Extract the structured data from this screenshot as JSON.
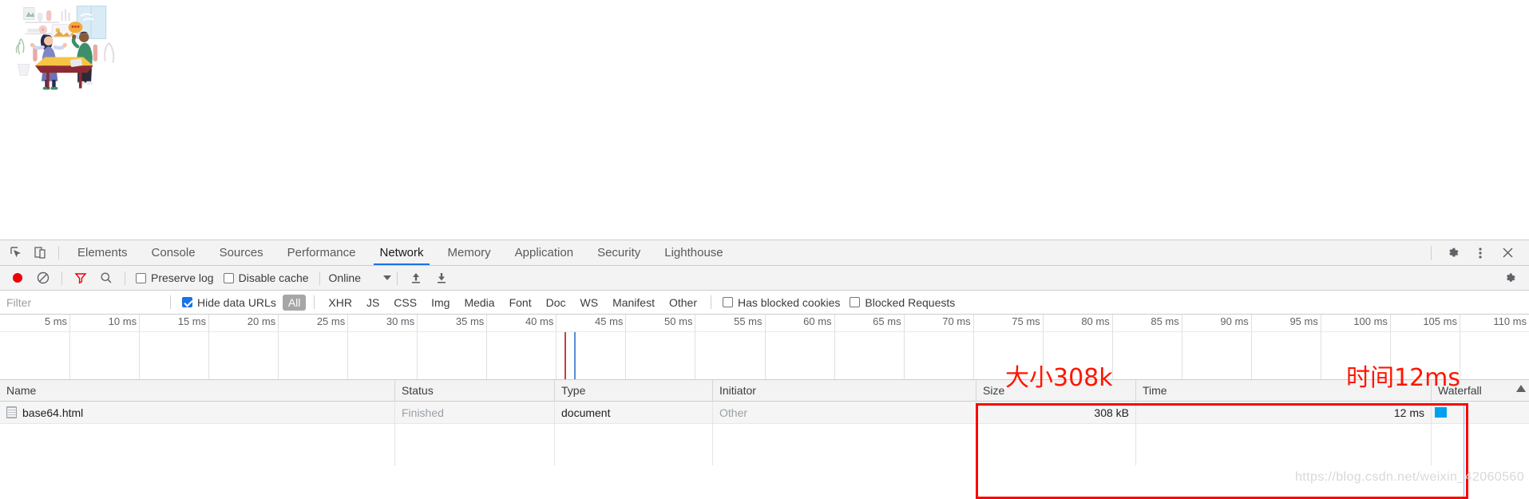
{
  "page": {
    "illustration_alt": "two-people-at-table-illustration"
  },
  "devtools": {
    "left_icons": [
      {
        "name": "inspect-element-icon",
        "glyph": "inspect"
      },
      {
        "name": "device-toolbar-icon",
        "glyph": "device"
      }
    ],
    "tabs": [
      {
        "label": "Elements",
        "active": false
      },
      {
        "label": "Console",
        "active": false
      },
      {
        "label": "Sources",
        "active": false
      },
      {
        "label": "Performance",
        "active": false
      },
      {
        "label": "Network",
        "active": true
      },
      {
        "label": "Memory",
        "active": false
      },
      {
        "label": "Application",
        "active": false
      },
      {
        "label": "Security",
        "active": false
      },
      {
        "label": "Lighthouse",
        "active": false
      }
    ],
    "right_icons": [
      {
        "name": "settings-gear-icon"
      },
      {
        "name": "more-options-kebab-icon"
      },
      {
        "name": "close-devtools-icon"
      }
    ]
  },
  "network_toolbar": {
    "record_button": "record-button",
    "clear_button": "clear-button",
    "filter_button": "filter-button",
    "search_button": "search-button",
    "preserve_log": {
      "label": "Preserve log",
      "checked": false
    },
    "disable_cache": {
      "label": "Disable cache",
      "checked": false
    },
    "throttling": {
      "value": "Online"
    },
    "import_button": "import-har-button",
    "export_button": "export-har-button",
    "settings_button": "network-settings-button",
    "colors": {
      "record_active": "#ee0000",
      "filter_active": "#ee0000",
      "accent": "#1a73e8"
    }
  },
  "filter_row": {
    "search_placeholder": "Filter",
    "search_value": "",
    "hide_data_urls": {
      "label": "Hide data URLs",
      "checked": true
    },
    "types": [
      {
        "label": "All",
        "selected": true
      },
      {
        "label": "XHR",
        "selected": false
      },
      {
        "label": "JS",
        "selected": false
      },
      {
        "label": "CSS",
        "selected": false
      },
      {
        "label": "Img",
        "selected": false
      },
      {
        "label": "Media",
        "selected": false
      },
      {
        "label": "Font",
        "selected": false
      },
      {
        "label": "Doc",
        "selected": false
      },
      {
        "label": "WS",
        "selected": false
      },
      {
        "label": "Manifest",
        "selected": false
      },
      {
        "label": "Other",
        "selected": false
      }
    ],
    "has_blocked_cookies": {
      "label": "Has blocked cookies",
      "checked": false
    },
    "blocked_requests": {
      "label": "Blocked Requests",
      "checked": false
    }
  },
  "overview": {
    "ticks": [
      "5 ms",
      "10 ms",
      "15 ms",
      "20 ms",
      "25 ms",
      "30 ms",
      "35 ms",
      "40 ms",
      "45 ms",
      "50 ms",
      "55 ms",
      "60 ms",
      "65 ms",
      "70 ms",
      "75 ms",
      "80 ms",
      "85 ms",
      "90 ms",
      "95 ms",
      "100 ms",
      "105 ms",
      "110 ms"
    ],
    "interval_ms": 5,
    "markers": [
      {
        "name": "dom-content-loaded-marker",
        "color": "#c64040",
        "at_ms": 42
      },
      {
        "name": "load-event-marker",
        "color": "#5a8dd4",
        "at_ms": 43.5
      }
    ]
  },
  "requests_table": {
    "columns": [
      {
        "key": "name",
        "label": "Name"
      },
      {
        "key": "status",
        "label": "Status"
      },
      {
        "key": "type",
        "label": "Type"
      },
      {
        "key": "initiator",
        "label": "Initiator"
      },
      {
        "key": "size",
        "label": "Size"
      },
      {
        "key": "time",
        "label": "Time"
      },
      {
        "key": "waterfall",
        "label": "Waterfall"
      }
    ],
    "sort_indicator": "ascending",
    "rows": [
      {
        "name": "base64.html",
        "status": "Finished",
        "type": "document",
        "initiator": "Other",
        "size": "308 kB",
        "time": "12 ms"
      }
    ]
  },
  "annotations": [
    {
      "name": "size-annotation",
      "text": "大小308k",
      "color": "#ff1500"
    },
    {
      "name": "time-annotation",
      "text": "时间12ms",
      "color": "#ff1500"
    }
  ],
  "watermark": {
    "text": "https://blog.csdn.net/weixin_42060560"
  }
}
